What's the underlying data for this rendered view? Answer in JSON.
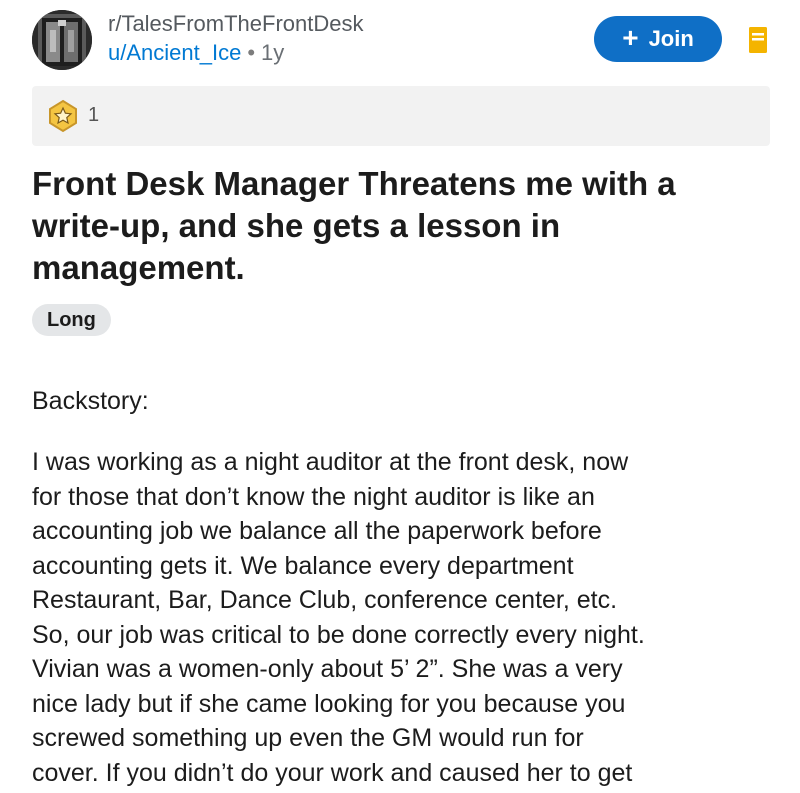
{
  "post": {
    "subreddit": "r/TalesFromTheFrontDesk",
    "author": "u/Ancient_Ice",
    "separator": "•",
    "age": "1y",
    "join_label": "Join",
    "award_count": "1",
    "title": "Front Desk Manager Threatens me with a write-up, and she gets a lesson in management.",
    "flair": "Long",
    "section_heading": "Backstory:",
    "body_lines": [
      "I was working as a night auditor at the front desk, now",
      "for those that don’t know the night auditor is like an",
      "accounting job we balance all the paperwork before",
      "accounting gets it. We balance every department",
      "Restaurant, Bar, Dance Club, conference center, etc.",
      "So, our job was critical to be done correctly every night.",
      "Vivian was a women-only about 5’ 2”. She was a very",
      "nice lady but if she came looking for you because you",
      "screwed something up even the GM would run for",
      "cover. If you didn’t do your work and caused her to get"
    ]
  },
  "colors": {
    "join_button": "#0f6fc6",
    "username": "#0079d3",
    "save_icon": "#f4b400",
    "award_gold": "#f4c542"
  },
  "icons": {
    "join": "plus-icon",
    "save": "bookmark-icon",
    "award": "award-star-icon"
  }
}
